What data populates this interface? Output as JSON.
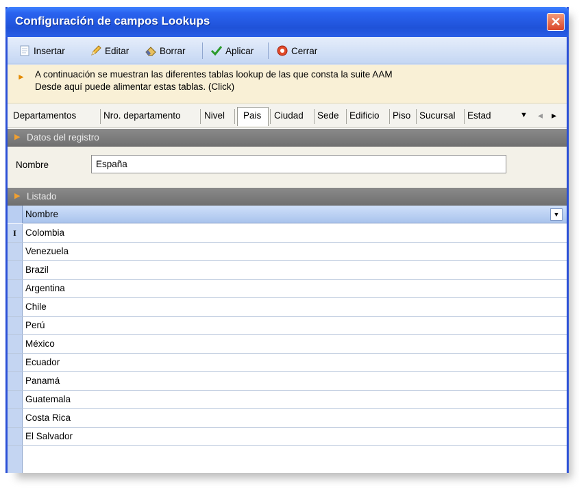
{
  "window": {
    "title": "Configuración de campos Lookups",
    "close_glyph": "✕"
  },
  "toolbar": {
    "insert_label": "Insertar",
    "edit_label": "Editar",
    "delete_label": "Borrar",
    "apply_label": "Aplicar",
    "close_label": "Cerrar"
  },
  "info": {
    "line1": "A continuación se muestran las diferentes tablas lookup de las que consta la suite AAM",
    "line2": "Desde aquí puede alimentar estas tablas. (Click)"
  },
  "tabs": {
    "items": [
      "Departamentos",
      "Nro. departamento",
      "Nivel",
      "Pais",
      "Ciudad",
      "Sede",
      "Edificio",
      "Piso",
      "Sucursal",
      "Estad"
    ],
    "active": "Pais",
    "dropdown_glyph": "▼",
    "prev_glyph": "◂",
    "next_glyph": "▸"
  },
  "record_section": {
    "header": "Datos del registro",
    "field_label": "Nombre",
    "field_value": "España"
  },
  "list_section": {
    "header": "Listado",
    "column_header": "Nombre",
    "current_row_marker": "I",
    "rows": [
      "Colombia",
      "Venezuela",
      "Brazil",
      "Argentina",
      "Chile",
      "Perú",
      "México",
      "Ecuador",
      "Panamá",
      "Guatemala",
      "Costa Rica",
      "El Salvador"
    ]
  },
  "colors": {
    "title_bar": "#2a63f0",
    "toolbar": "#c4d6f3",
    "info_bar": "#f9f0d6",
    "section_header": "#7a7a7a",
    "grid_header": "#a9c3ec"
  }
}
